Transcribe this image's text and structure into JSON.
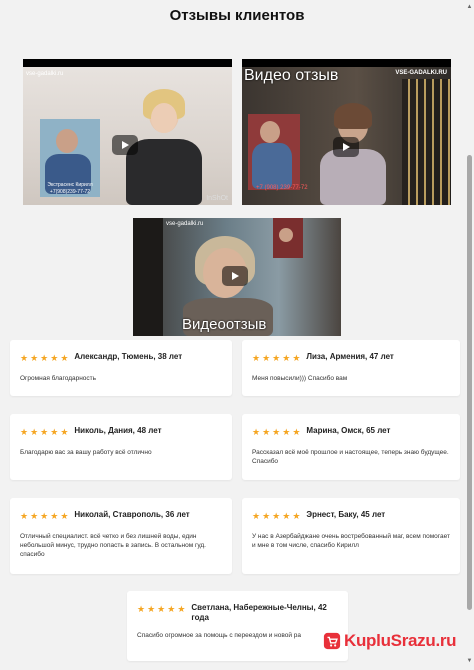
{
  "page": {
    "title": "Отзывы клиентов"
  },
  "videos": {
    "v1": {
      "watermark": "vse-gadalki.ru",
      "inset_name": "Экстрасенс Кирилл",
      "inset_phone": "+7(908)239-77-72",
      "corner_mark": "InShOt"
    },
    "v2": {
      "caption": "Видео отзыв",
      "watermark": "VSE-GADALKI.RU",
      "phone": "+7 (908) 239-77-72"
    },
    "v3": {
      "caption": "Видеоотзыв",
      "watermark": "vse-gadalki.ru"
    }
  },
  "reviews": [
    {
      "stars": 5,
      "author": "Александр, Тюмень, 38 лет",
      "text": "Огромная благодарность"
    },
    {
      "stars": 5,
      "author": "Лиза, Армения, 47 лет",
      "text": "Меня повысили))) Спасибо вам"
    },
    {
      "stars": 5,
      "author": "Николь, Дания, 48 лет",
      "text": "Благодарю вас за вашу работу всё отлично"
    },
    {
      "stars": 5,
      "author": "Марина, Омск, 65 лет",
      "text": "Рассказал всё моё прошлое и настоящее, теперь знаю будущее. Спасибо"
    },
    {
      "stars": 5,
      "author": "Николай, Ставрополь, 36 лет",
      "text": "Отличный специалист. всё четко и без лишней воды, един небольшой минус, трудно попасть в запись. В остальном гуд. спасибо"
    },
    {
      "stars": 5,
      "author": "Эрнест, Баку, 45 лет",
      "text": "У нас в Азербайджане очень востребованный маг, всем помогает и мне в том числе, спасибо Кирилл"
    },
    {
      "stars": 5,
      "author": "Светлана, Набережные-Челны, 42 года",
      "text": "Спасибо огромное за помощь с переездом и новой ра"
    }
  ],
  "star_glyph": "★",
  "watermark_site": {
    "text": "KupluSrazu.ru",
    "color": "#e8303a"
  },
  "colors": {
    "star": "#f5a623",
    "background": "#f2f2f2"
  }
}
